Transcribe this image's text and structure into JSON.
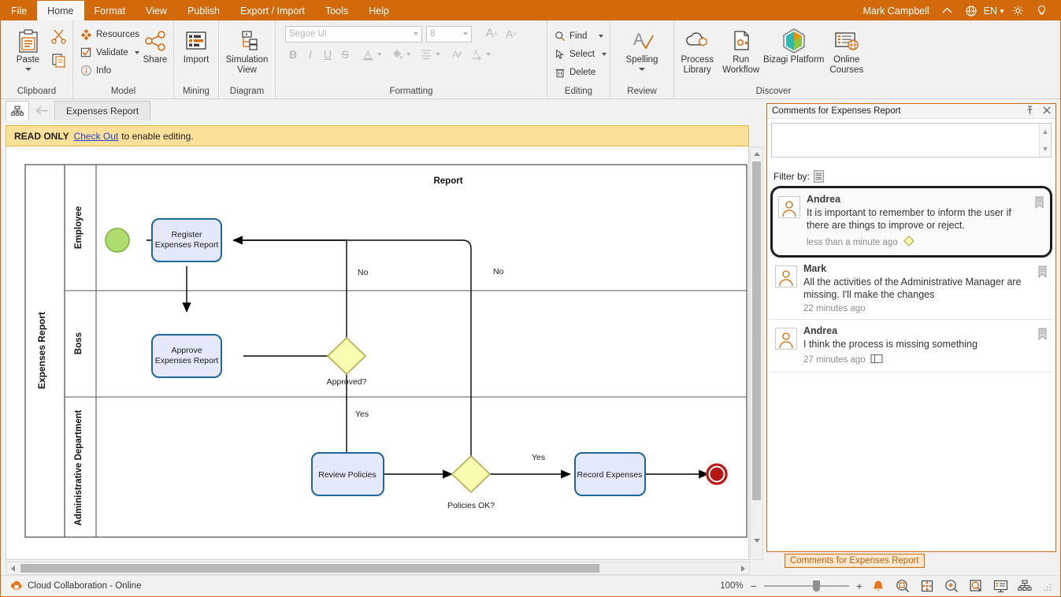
{
  "menu": {
    "items": [
      {
        "label": "File",
        "active": false
      },
      {
        "label": "Home",
        "active": true
      },
      {
        "label": "Format",
        "active": false
      },
      {
        "label": "View",
        "active": false
      },
      {
        "label": "Publish",
        "active": false
      },
      {
        "label": "Export / Import",
        "active": false
      },
      {
        "label": "Tools",
        "active": false
      },
      {
        "label": "Help",
        "active": false
      }
    ],
    "user": "Mark Campbell",
    "language": "EN"
  },
  "ribbon": {
    "groups": [
      {
        "title": "Clipboard",
        "big": [
          {
            "label": "Paste",
            "icon": "paste-icon",
            "has_caret": true
          }
        ],
        "small": [
          {
            "label": "",
            "icon": "cut-icon"
          },
          {
            "label": "",
            "icon": "copy-icon"
          }
        ]
      },
      {
        "title": "Model",
        "small": [
          {
            "label": "Resources",
            "icon": "resources-icon",
            "has_caret": false
          },
          {
            "label": "Validate",
            "icon": "validate-icon",
            "has_caret": true
          },
          {
            "label": "Info",
            "icon": "info-icon",
            "has_caret": false
          }
        ],
        "big": [
          {
            "label": "Share",
            "icon": "share-icon",
            "has_caret": false
          }
        ]
      },
      {
        "title": "Mining",
        "big": [
          {
            "label": "Import",
            "icon": "import-icon",
            "has_caret": false
          }
        ]
      },
      {
        "title": "Diagram",
        "big": [
          {
            "label": "Simulation View",
            "icon": "simulation-view-icon",
            "has_caret": false
          }
        ]
      },
      {
        "title": "Formatting",
        "font_name": "Segoe UI",
        "font_size": "8",
        "buttons": [
          "B",
          "I",
          "U",
          "S"
        ]
      },
      {
        "title": "Editing",
        "small": [
          {
            "label": "Find",
            "icon": "find-icon",
            "has_caret": true
          },
          {
            "label": "Select",
            "icon": "select-icon",
            "has_caret": true
          },
          {
            "label": "Delete",
            "icon": "delete-icon",
            "has_caret": false
          }
        ]
      },
      {
        "title": "Review",
        "big": [
          {
            "label": "Spelling",
            "icon": "spelling-icon",
            "has_caret": true
          }
        ]
      },
      {
        "title": "Discover",
        "big": [
          {
            "label": "Process Library",
            "icon": "process-library-icon"
          },
          {
            "label": "Run Workflow",
            "icon": "run-workflow-icon"
          },
          {
            "label": "Bizagi Platform",
            "icon": "bizagi-platform-icon"
          },
          {
            "label": "Online Courses",
            "icon": "online-courses-icon"
          }
        ]
      }
    ]
  },
  "tabstrip": {
    "document_tab": "Expenses Report"
  },
  "readonly_bar": {
    "prefix": "READ ONLY",
    "link": "Check Out",
    "suffix": "to enable editing."
  },
  "diagram": {
    "pool_label": "Expenses Report",
    "title": "Report",
    "lanes": [
      "Employee",
      "Boss",
      "Administrative Department"
    ],
    "nodes": [
      {
        "id": "start",
        "type": "start-event",
        "label": ""
      },
      {
        "id": "register",
        "type": "task",
        "label": "Register\nExpenses Report"
      },
      {
        "id": "approve",
        "type": "task",
        "label": "Approve\nExpenses Report"
      },
      {
        "id": "gw1",
        "type": "gateway",
        "label": "Approved?"
      },
      {
        "id": "review",
        "type": "task",
        "label": "Review Policies"
      },
      {
        "id": "gw2",
        "type": "gateway",
        "label": "Policies OK?"
      },
      {
        "id": "record",
        "type": "task",
        "label": "Record Expenses"
      },
      {
        "id": "end",
        "type": "end-event",
        "label": ""
      }
    ],
    "flow_labels": {
      "no1": "No",
      "no2": "No",
      "yes1": "Yes",
      "yes2": "Yes"
    },
    "colors": {
      "task_fill": "#e3e9fa",
      "task_stroke": "#1f6699",
      "gateway_fill": "#fafcb0",
      "gateway_stroke": "#b2b254",
      "start_fill": "#aedc6e",
      "start_stroke": "#7eb23c",
      "end_fill": "#b51616",
      "end_stroke": "#c52222"
    }
  },
  "comments": {
    "title": "Comments for Expenses Report",
    "filter_label": "Filter by:",
    "input_value": "",
    "items": [
      {
        "author": "Andrea",
        "text": "It is important to remember to inform the user if there are things to improve or reject.",
        "time": "less than a minute ago",
        "selected": true,
        "marker": "diamond"
      },
      {
        "author": "Mark",
        "text": "All the activities of the Administrative Manager are missing. I'll make the changes",
        "time": "22 minutes ago",
        "selected": false,
        "marker": ""
      },
      {
        "author": "Andrea",
        "text": "I think the process is missing something",
        "time": "27 minutes ago",
        "selected": false,
        "marker": "square"
      }
    ],
    "tab_label": "Comments for Expenses Report"
  },
  "status": {
    "cloud_label": "Cloud Collaboration - Online",
    "zoom": "100%",
    "icons": [
      "alert-bell-icon",
      "zoom-fit-icon",
      "fit-page-icon",
      "zoom-in-icon",
      "zoom-selection-icon",
      "presentation-icon",
      "diagram-view-icon"
    ]
  },
  "theme": {
    "accent": "#d2690a",
    "warn_bg": "#fbe09a",
    "link": "#2a3fcf"
  }
}
